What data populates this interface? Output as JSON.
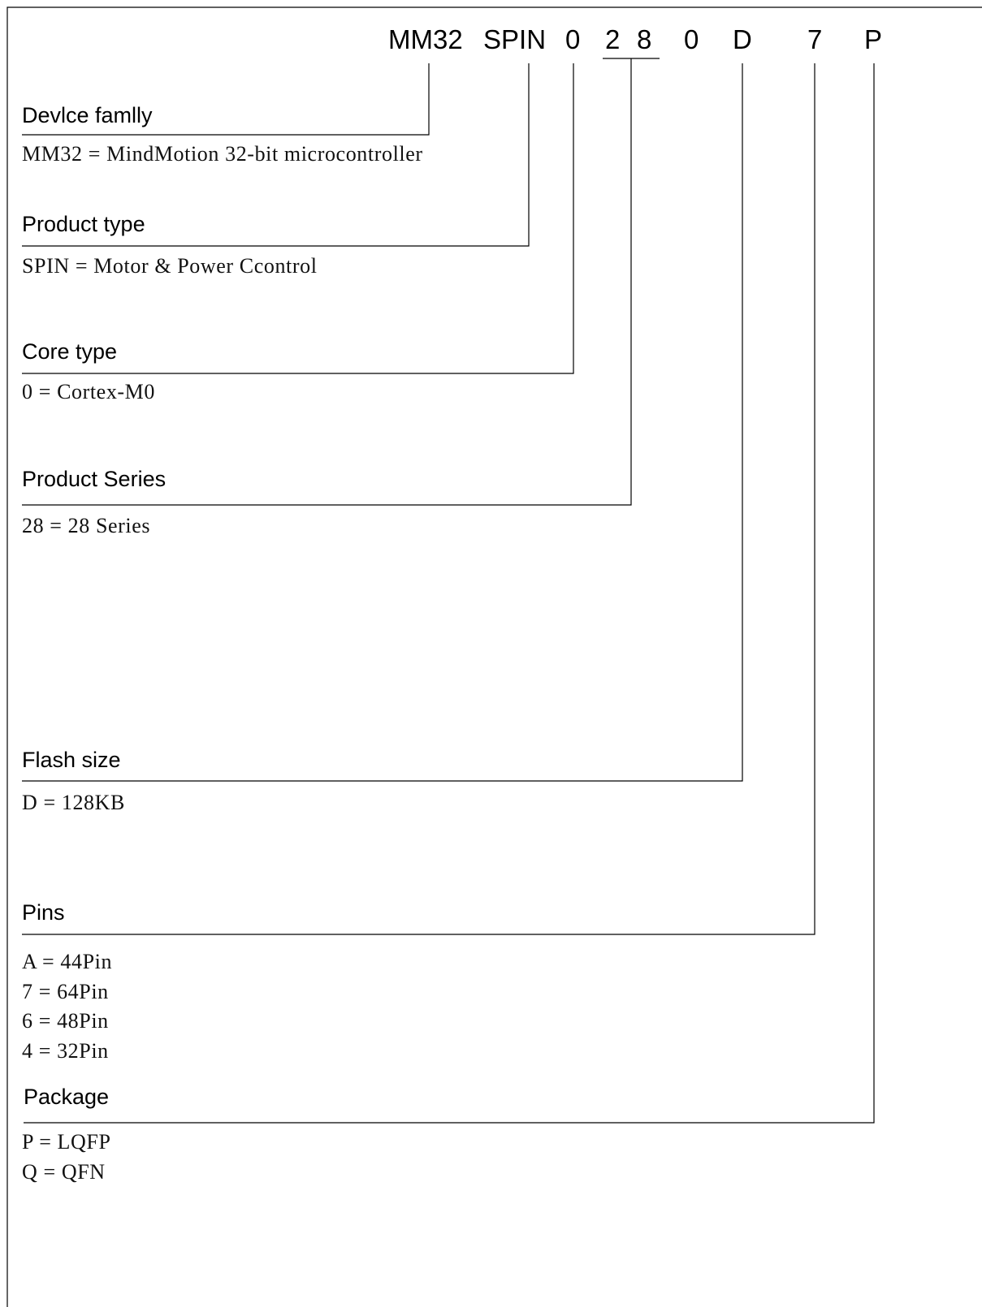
{
  "part_number": {
    "segments": [
      "MM32",
      "SPIN",
      "0",
      "2",
      "8",
      "0",
      "D",
      "7",
      "P"
    ]
  },
  "fields": [
    {
      "heading": "Devlce famlly",
      "descriptions": [
        "MM32 = MindMotion 32-bit microcontroller"
      ]
    },
    {
      "heading": "Product type",
      "descriptions": [
        "SPIN = Motor & Power Ccontrol"
      ]
    },
    {
      "heading": "Core type",
      "descriptions": [
        "0 = Cortex-M0"
      ]
    },
    {
      "heading": "Product Series",
      "descriptions": [
        "28 = 28 Series"
      ]
    },
    {
      "heading": "Flash size",
      "descriptions": [
        "D = 128KB"
      ]
    },
    {
      "heading": "Pins",
      "descriptions": [
        "A = 44Pin",
        "7 = 64Pin",
        "6 = 48Pin",
        "4 = 32Pin"
      ]
    },
    {
      "heading": "Package",
      "descriptions": [
        "P = LQFP",
        "Q = QFN"
      ]
    }
  ]
}
